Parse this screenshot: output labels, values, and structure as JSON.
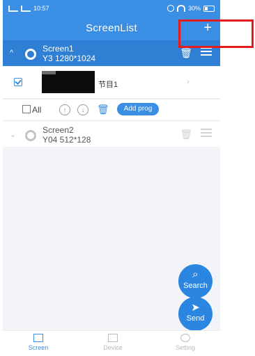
{
  "status": {
    "time": "10:57",
    "battery": "30%"
  },
  "header": {
    "title": "ScreenList",
    "add_label": "+"
  },
  "screens": [
    {
      "name": "Screen1",
      "spec": "Y3  1280*1024"
    },
    {
      "name": "Screen2",
      "spec": "Y04  512*128"
    }
  ],
  "program": {
    "name": "节目1"
  },
  "toolbar": {
    "all_label": "All",
    "add_prog_label": "Add prog"
  },
  "fab": {
    "search_label": "Search",
    "send_label": "Send"
  },
  "tabs": {
    "screen_label": "Screen",
    "device_label": "Device",
    "setting_label": "Setting"
  },
  "colors": {
    "accent": "#3a8ee3",
    "highlight_red": "#e31d1d"
  }
}
